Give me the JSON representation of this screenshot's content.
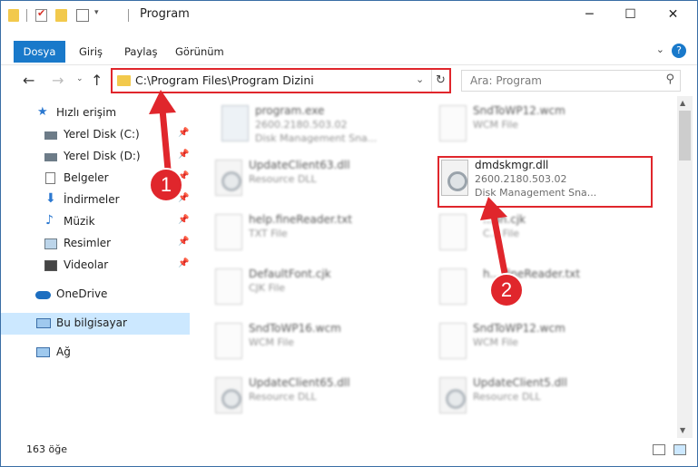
{
  "window": {
    "title": "Program",
    "minimize_icon": "minimize-icon",
    "maximize_icon": "maximize-icon",
    "close_icon": "close-icon"
  },
  "ribbon": {
    "tabs": [
      {
        "label": "Dosya",
        "active": true
      },
      {
        "label": "Giriş",
        "active": false
      },
      {
        "label": "Paylaş",
        "active": false
      },
      {
        "label": "Görünüm",
        "active": false
      }
    ]
  },
  "nav": {
    "address": "C:\\Program Files\\Program Dizini",
    "search_placeholder": "Ara: Program"
  },
  "sidebar": {
    "items": [
      {
        "label": "Hızlı erişim",
        "icon": "star-icon",
        "pinned": false,
        "selected": false
      },
      {
        "label": "Yerel Disk (C:)",
        "icon": "drive-icon",
        "pinned": true,
        "selected": false
      },
      {
        "label": "Yerel Disk (D:)",
        "icon": "drive-icon",
        "pinned": true,
        "selected": false
      },
      {
        "label": "Belgeler",
        "icon": "documents-icon",
        "pinned": true,
        "selected": false
      },
      {
        "label": "İndirmeler",
        "icon": "downloads-icon",
        "pinned": true,
        "selected": false
      },
      {
        "label": "Müzik",
        "icon": "music-icon",
        "pinned": true,
        "selected": false
      },
      {
        "label": "Resimler",
        "icon": "pictures-icon",
        "pinned": true,
        "selected": false
      },
      {
        "label": "Videolar",
        "icon": "videos-icon",
        "pinned": true,
        "selected": false
      },
      {
        "label": "OneDrive",
        "icon": "cloud-icon",
        "pinned": false,
        "selected": false
      },
      {
        "label": "Bu bilgisayar",
        "icon": "computer-icon",
        "pinned": false,
        "selected": true
      },
      {
        "label": "Ağ",
        "icon": "network-icon",
        "pinned": false,
        "selected": false
      }
    ]
  },
  "files": [
    {
      "name": "program.exe",
      "line2": "2600.2180.503.02",
      "line3": "Disk Management Sna...",
      "type": "exe"
    },
    {
      "name": "SndToWP12.wcm",
      "line2": "WCM File",
      "line3": "",
      "type": "doc"
    },
    {
      "name": "UpdateClient63.dll",
      "line2": "Resource DLL",
      "line3": "",
      "type": "dll"
    },
    {
      "name": "dmdskmgr.dll",
      "line2": "2600.2180.503.02",
      "line3": "Disk Management Sna...",
      "type": "dll",
      "highlighted": true
    },
    {
      "name": "help.fineReader.txt",
      "line2": "TXT File",
      "line3": "",
      "type": "doc"
    },
    {
      "name": "...an.cjk",
      "line2": "C... File",
      "line3": "",
      "type": "doc"
    },
    {
      "name": "DefaultFont.cjk",
      "line2": "CJK File",
      "line3": "",
      "type": "doc"
    },
    {
      "name": "h... fineReader.txt",
      "line2": "",
      "line3": "",
      "type": "doc"
    },
    {
      "name": "SndToWP16.wcm",
      "line2": "WCM File",
      "line3": "",
      "type": "doc"
    },
    {
      "name": "SndToWP12.wcm",
      "line2": "WCM File",
      "line3": "",
      "type": "doc"
    },
    {
      "name": "UpdateClient65.dll",
      "line2": "Resource DLL",
      "line3": "",
      "type": "dll"
    },
    {
      "name": "UpdateClient5.dll",
      "line2": "Resource DLL",
      "line3": "",
      "type": "dll"
    }
  ],
  "status": {
    "count": "163 öğe"
  },
  "annotations": {
    "step1": "1",
    "step2": "2",
    "color": "#e0262c"
  }
}
